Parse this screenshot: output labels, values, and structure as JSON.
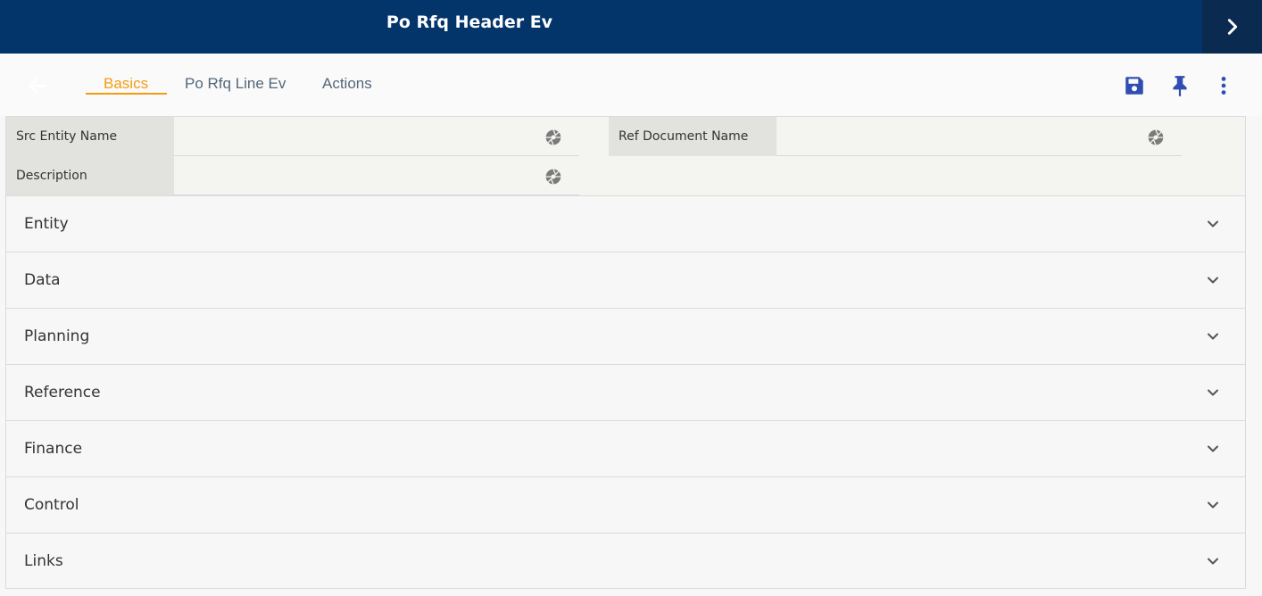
{
  "header": {
    "title": "Po Rfq Header Ev",
    "expand_icon": "chevron-right-icon"
  },
  "toolbar": {
    "back_icon": "arrow-left-icon",
    "tabs": [
      {
        "label": "Basics",
        "active": true
      },
      {
        "label": "Po Rfq Line Ev",
        "active": false
      },
      {
        "label": "Actions",
        "active": false
      }
    ],
    "save_icon": "save-icon",
    "pin_icon": "pin-icon",
    "more_icon": "more-vertical-icon"
  },
  "fields": [
    {
      "label": "Src Entity Name",
      "value": ""
    },
    {
      "label": "Ref Document Name",
      "value": ""
    },
    {
      "label": "Description",
      "value": ""
    }
  ],
  "sections": [
    {
      "label": "Entity"
    },
    {
      "label": "Data"
    },
    {
      "label": "Planning"
    },
    {
      "label": "Reference"
    },
    {
      "label": "Finance"
    },
    {
      "label": "Control"
    },
    {
      "label": "Links"
    }
  ],
  "colors": {
    "header_bg": "#03346a",
    "expand_bg": "#0b2a50",
    "active_tab": "#f39c12",
    "icon_blue": "#2f4db3"
  }
}
